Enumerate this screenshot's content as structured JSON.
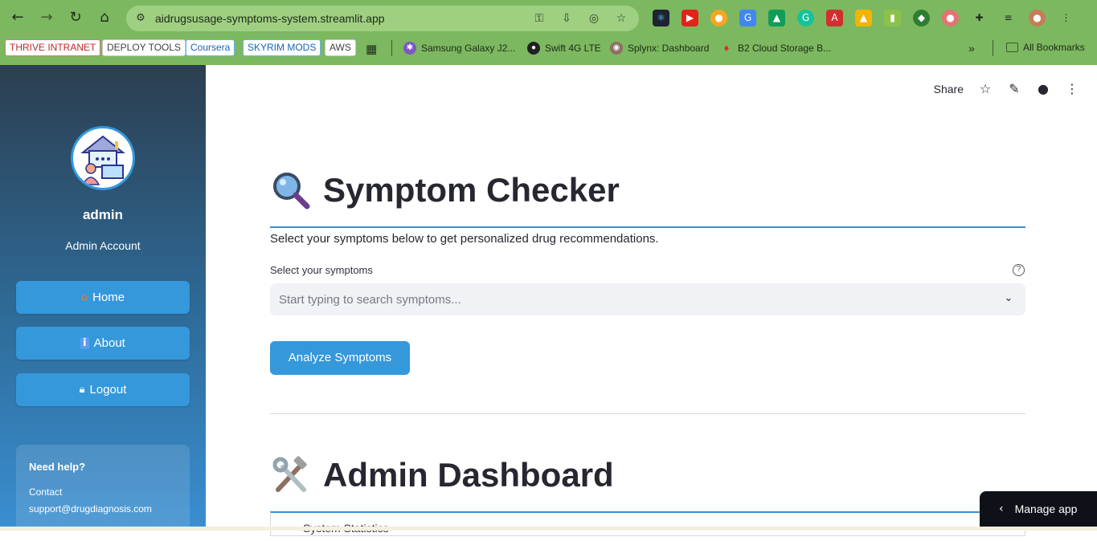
{
  "browser": {
    "url": "aidrugsusage-symptoms-system.streamlit.app",
    "bookmarks": {
      "tags": [
        "THRIVE INTRANET",
        "DEPLOY TOOLS",
        "Coursera",
        "SKYRIM MODS",
        "AWS"
      ],
      "items": [
        "Samsung Galaxy J2...",
        "Swift 4G LTE",
        "Splynx: Dashboard",
        "B2 Cloud Storage B..."
      ],
      "more": "»",
      "all_bookmarks": "All Bookmarks"
    },
    "colors": {
      "chrome": "#7cb85f",
      "omnibox": "#9fd082"
    }
  },
  "sidebar": {
    "user_name": "admin",
    "user_role": "Admin Account",
    "nav": [
      {
        "icon": "home-icon",
        "label": "Home"
      },
      {
        "icon": "info-icon",
        "label": "About"
      },
      {
        "icon": "lock-icon",
        "label": "Logout"
      }
    ],
    "help": {
      "title": "Need help?",
      "contact_label": "Contact",
      "contact_email": "support@drugdiagnosis.com"
    }
  },
  "main": {
    "header": {
      "share_label": "Share"
    },
    "symptom_checker": {
      "title": "Symptom Checker",
      "subtitle": "Select your symptoms below to get personalized drug recommendations.",
      "field_label": "Select your symptoms",
      "placeholder": "Start typing to search symptoms...",
      "analyze_label": "Analyze Symptoms"
    },
    "admin_dashboard": {
      "title": "Admin Dashboard",
      "expander_label": "System Statistics"
    },
    "manage_app_label": "Manage app",
    "colors": {
      "accent": "#3498db",
      "text": "#262730"
    }
  }
}
